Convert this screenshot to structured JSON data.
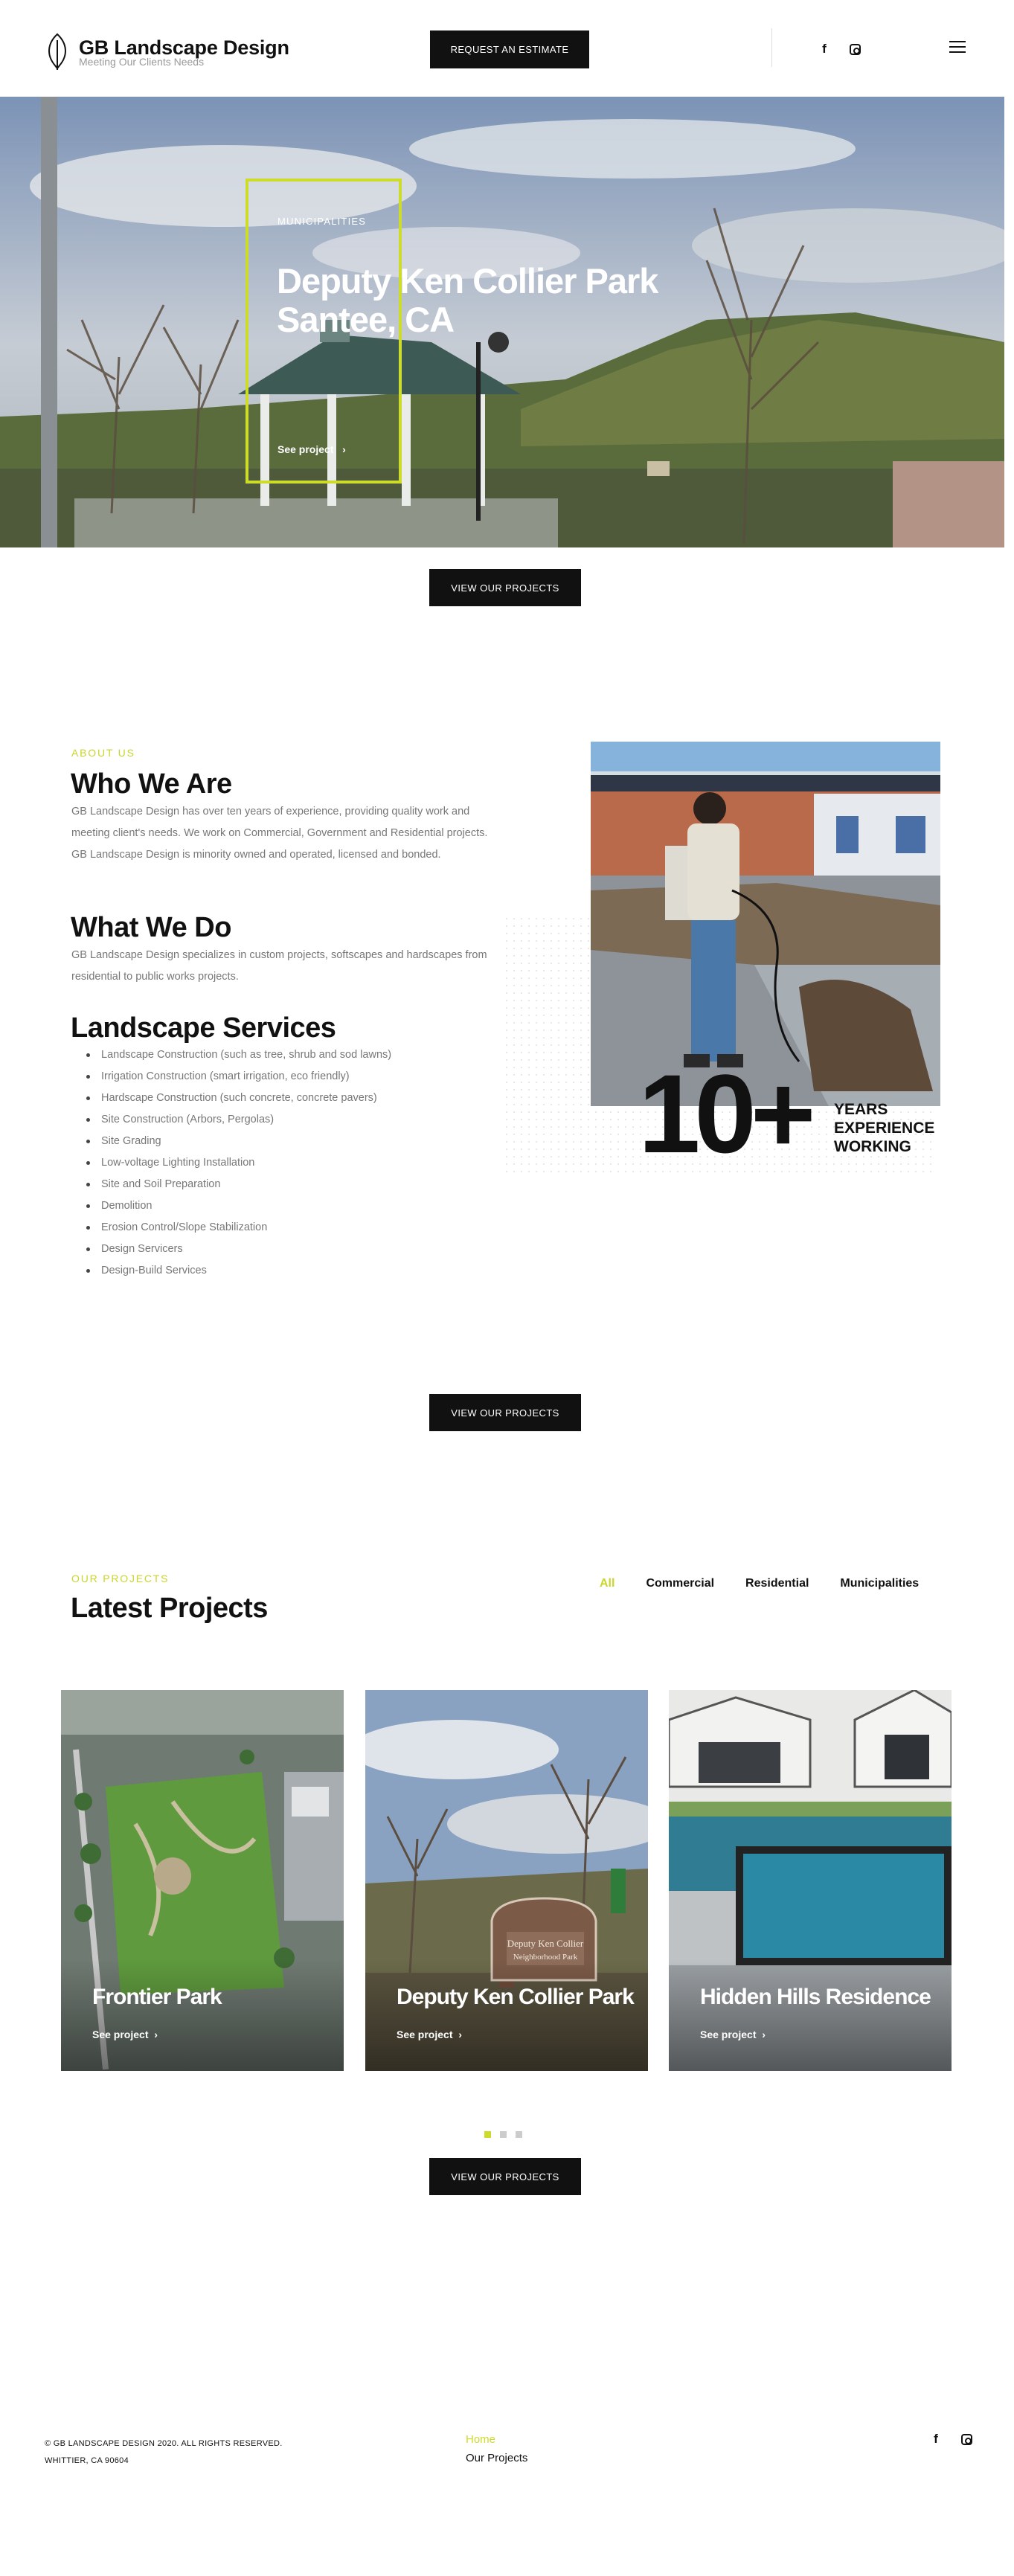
{
  "header": {
    "logo_title": "GB Landscape Design",
    "logo_tagline": "Meeting Our Clients Needs",
    "estimate_button": "REQUEST AN ESTIMATE",
    "social": {
      "facebook": "f"
    }
  },
  "hero": {
    "category": "MUNICIPALITIES",
    "title_line1": "Deputy Ken Collier Park",
    "title_line2": "Santee, CA",
    "link": "See project"
  },
  "view_projects_label": "VIEW OUR PROJECTS",
  "about": {
    "kicker": "ABOUT US",
    "who_title": "Who We Are",
    "who_text": "GB Landscape Design has over ten years of experience, providing quality work and meeting client's needs. We work on Commercial, Government and Residential projects. GB Landscape Design is minority owned and operated, licensed and bonded.",
    "what_title": "What We Do",
    "what_text": "GB Landscape Design specializes in custom projects, softscapes and hardscapes from residential to public works projects.",
    "services_title": "Landscape Services",
    "services": [
      "Landscape Construction (such as tree, shrub and sod lawns)",
      "Irrigation Construction (smart irrigation, eco friendly)",
      "Hardscape Construction (such concrete, concrete pavers)",
      "Site Construction (Arbors, Pergolas)",
      "Site Grading",
      "Low-voltage Lighting Installation",
      "Site and Soil Preparation",
      "Demolition",
      "Erosion Control/Slope Stabilization",
      "Design Servicers",
      "Design-Build Services"
    ],
    "years_number": "10+",
    "years_label": [
      "YEARS",
      "EXPERIENCE",
      "WORKING"
    ]
  },
  "projects": {
    "kicker": "OUR PROJECTS",
    "title": "Latest Projects",
    "filters": [
      "All",
      "Commercial",
      "Residential",
      "Municipalities"
    ],
    "cards": [
      {
        "title": "Frontier Park",
        "link": "See project"
      },
      {
        "title": "Deputy Ken Collier Park",
        "link": "See project",
        "sign_line1": "Deputy Ken Collier",
        "sign_line2": "Neighborhood Park"
      },
      {
        "title": "Hidden Hills Residence",
        "link": "See project"
      }
    ],
    "active_page": 1,
    "page_count": 3
  },
  "footer": {
    "copyright": "© GB LANDSCAPE DESIGN 2020. ALL RIGHTS RESERVED.",
    "address": "WHITTIER, CA 90604",
    "nav": [
      "Home",
      "Our Projects"
    ]
  },
  "colors": {
    "accent": "#cddc2a",
    "dark": "#111111",
    "muted": "#777777"
  }
}
